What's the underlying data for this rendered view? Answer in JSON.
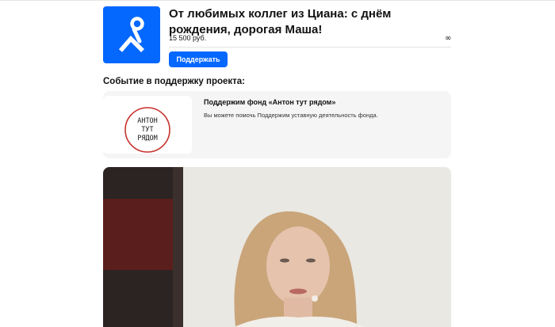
{
  "campaign": {
    "title": "От любимых коллег из Циана: с днём рождения, дорогая Маша!",
    "amount": "15 500 руб.",
    "goal_symbol": "∞",
    "support_button_label": "Поддержать"
  },
  "event_section": {
    "heading": "Событие в поддержку проекта:"
  },
  "fund": {
    "name": "Поддержим фонд «Антон тут рядом»",
    "description": "Вы можете помочь Поддержим уставную деятельность фонда.",
    "logo_lines": [
      "АНТОН",
      "ТУТ",
      "РЯДОМ"
    ]
  },
  "colors": {
    "brand_blue": "#0468ff",
    "fund_circle_red": "#c8312c"
  },
  "icons": {
    "campaign_logo": "cian-pin-logo-icon",
    "infinity": "infinity-icon"
  }
}
